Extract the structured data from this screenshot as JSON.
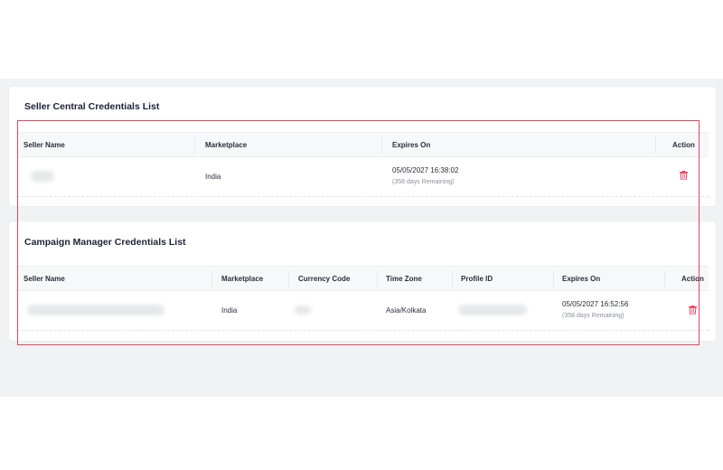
{
  "seller_central": {
    "title": "Seller Central Credentials List",
    "columns": [
      "Seller Name",
      "Marketplace",
      "Expires On",
      "Action"
    ],
    "rows": [
      {
        "marketplace": "India",
        "expires_on": "05/05/2027 16:38:02",
        "remaining": "(358 days Remaining)"
      }
    ]
  },
  "campaign_manager": {
    "title": "Campaign Manager Credentials List",
    "columns": [
      "Seller Name",
      "Marketplace",
      "Currency Code",
      "Time Zone",
      "Profile ID",
      "Expires On",
      "Action"
    ],
    "rows": [
      {
        "marketplace": "India",
        "time_zone": "Asia/Kolkata",
        "expires_on": "05/05/2027 16:52:56",
        "remaining": "(358 days Remaining)"
      }
    ]
  },
  "colors": {
    "highlight_border": "#e8425f",
    "delete_icon": "#e8425f",
    "page_bg": "#f1f2f4"
  },
  "icons": {
    "delete": "trash-icon"
  }
}
